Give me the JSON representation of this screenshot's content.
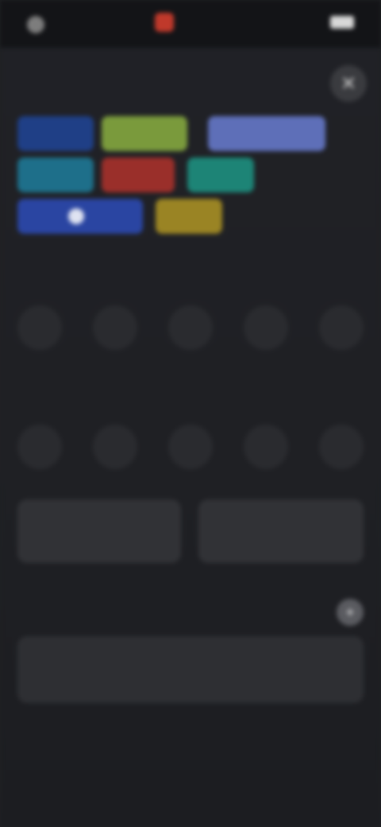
{
  "status_bar": {
    "time": "",
    "app_name": "",
    "battery": ""
  },
  "close_icon": "close-icon",
  "topics": {
    "heading": "",
    "chips": [
      {
        "label": "",
        "color": "#1f3f86"
      },
      {
        "label": "",
        "color": "#7a9a3c"
      },
      {
        "label": "",
        "color": "#5e6fb8"
      },
      {
        "label": "",
        "color": "#1e6f8a"
      },
      {
        "label": "",
        "color": "#9a2f2a"
      },
      {
        "label": "",
        "color": "#1d8476"
      },
      {
        "label": "",
        "color": "#2a45a2"
      },
      {
        "label": "",
        "color": "#9a8424"
      },
      {
        "label": ""
      }
    ]
  },
  "rating_1": {
    "heading": "",
    "options": [
      "",
      "",
      "",
      "",
      ""
    ]
  },
  "rating_2": {
    "heading": "",
    "options": [
      "",
      "",
      "",
      "",
      ""
    ]
  },
  "actions": {
    "left_line1": "",
    "left_line2": "",
    "right": ""
  },
  "comment": {
    "label": "",
    "toggle_icon": "plus-icon",
    "placeholder": ""
  }
}
